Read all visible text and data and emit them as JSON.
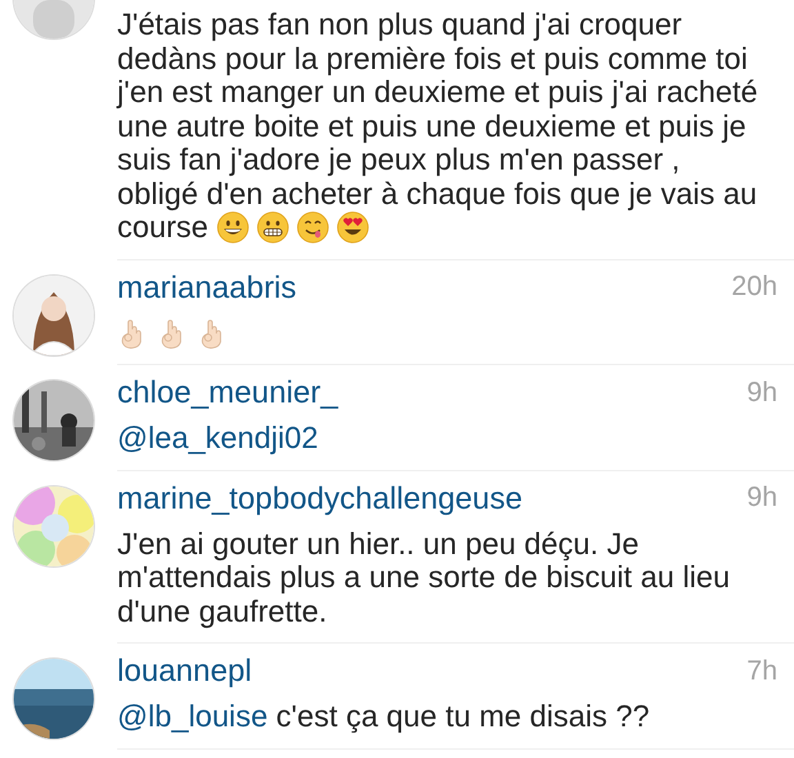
{
  "comments": [
    {
      "avatar": {
        "kind": "picture"
      },
      "body": [
        {
          "kind": "text",
          "text": "J'étais pas fan non plus quand j'ai croquer dedàns pour la première fois et puis comme toi j'en est manger un deuxieme et puis j'ai racheté une autre boite et puis une deuxieme et puis je suis fan j'adore je peux plus m'en passer , obligé d'en acheter à chaque fois que je vais au course"
        }
      ],
      "emoji": [
        {
          "kind": "grin"
        },
        {
          "kind": "grimace"
        },
        {
          "kind": "yum"
        },
        {
          "kind": "heart_eyes"
        }
      ]
    },
    {
      "avatar": {
        "kind": "picture"
      },
      "username": "marianaabris",
      "time": "20h",
      "emoji": [
        {
          "kind": "ok_hand"
        },
        {
          "kind": "ok_hand"
        },
        {
          "kind": "ok_hand"
        }
      ]
    },
    {
      "avatar": {
        "kind": "picture"
      },
      "username": "chloe_meunier_",
      "time": "9h",
      "body": [
        {
          "kind": "mention",
          "text": "@lea_kendji02"
        }
      ]
    },
    {
      "avatar": {
        "kind": "picture"
      },
      "username": "marine_topbodychallengeuse",
      "time": "9h",
      "body": [
        {
          "kind": "text",
          "text": "J'en ai gouter un hier.. un peu déçu. Je m'attendais plus a une sorte de biscuit au lieu d'une gaufrette."
        }
      ]
    },
    {
      "avatar": {
        "kind": "picture"
      },
      "username": "louannepl",
      "time": "7h",
      "body": [
        {
          "kind": "mention",
          "text": "@lb_louise"
        },
        {
          "kind": "text",
          "text": " c'est ça que tu me disais ??"
        }
      ]
    }
  ]
}
